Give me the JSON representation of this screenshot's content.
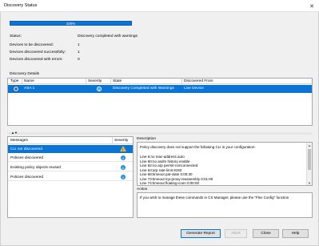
{
  "window": {
    "title": "Discovery Status",
    "close_glyph": "✕"
  },
  "progress": {
    "label": "100%",
    "value": 1.0
  },
  "status": {
    "status_label": "Status:",
    "status_value": "Discovery completed with warnings",
    "devices_to_discover_label": "Devices to be discovered:",
    "devices_to_discover_value": "1",
    "discovered_success_label": "Devices discovered successfully:",
    "discovered_success_value": "1",
    "discovered_errors_label": "Devices discovered with errors:",
    "discovered_errors_value": "0"
  },
  "details": {
    "section_label": "Discovery Details",
    "columns": {
      "type": "Type",
      "name": "Name",
      "severity": "Severity",
      "state": "State",
      "discovered_from": "Discovered From"
    },
    "rows": [
      {
        "type_icon": "device-icon",
        "name": "ASA 1",
        "severity_icon": "info-icon",
        "state": "Discovery Completed with Warnings",
        "discovered_from": "Live Device"
      }
    ]
  },
  "splitter": {
    "arrows": "▲▼"
  },
  "messages": {
    "columns": {
      "messages": "Messages",
      "severity": "Severity"
    },
    "rows": [
      {
        "text": "CLI not discovered",
        "severity_icon": "warning-icon",
        "selected": true
      },
      {
        "text": "Policies discovered",
        "severity_icon": "info-icon",
        "selected": false
      },
      {
        "text": "Existing policy objects reused",
        "severity_icon": "info-icon",
        "selected": false
      },
      {
        "text": "Policies discovered",
        "severity_icon": "info-icon",
        "selected": false
      }
    ]
  },
  "description": {
    "label": "Description",
    "lines": [
      "Policy discovery does not support the following CLI in your configuration:",
      "",
      "Line 6:no mac-address auto",
      "Line 60:no asdm history enable",
      "Line 62:no arp permit-nonconnected",
      "Line 63:arp rate-limit 8192",
      "Line 68:timeout pat-xlate 0:00:30",
      "Line 73:timeout tcp-proxy-reassembly 0:01:00",
      "Line 74:timeout floating-conn 0:00:00"
    ]
  },
  "action": {
    "label": "Action",
    "text": "If you wish to manage these commands in CS Manager, please use the \"Flex Config\" function"
  },
  "buttons": {
    "generate_report": "Generate Report",
    "abort": "Abort",
    "close": "Close",
    "help": "Help"
  },
  "colors": {
    "selection": "#0a75d6",
    "warning": "#f2b52a",
    "info": "#1f8fd8"
  }
}
